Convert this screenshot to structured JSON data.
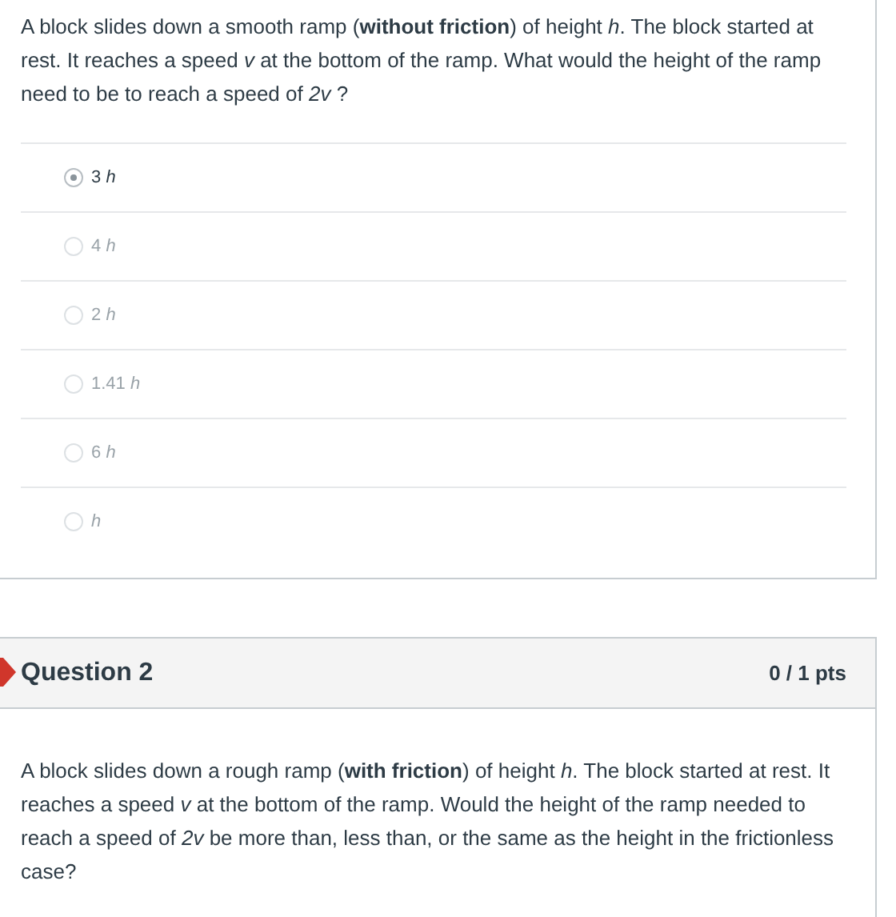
{
  "question_1": {
    "text": "A block slides down a smooth ramp (**without friction**) of height *h*.  The block started at rest.  It reaches a speed *v* at the bottom of the ramp.  What would the height of the ramp need to be to reach a speed of *2v* ?",
    "answers": [
      {
        "label": "3 *h*",
        "selected": true
      },
      {
        "label": "4 *h*",
        "selected": false
      },
      {
        "label": "2 *h*",
        "selected": false
      },
      {
        "label": "1.41 *h*",
        "selected": false
      },
      {
        "label": "6 *h*",
        "selected": false
      },
      {
        "label": "*h*",
        "selected": false
      }
    ]
  },
  "question_2": {
    "title": "Question 2",
    "points": "0 / 1 pts",
    "incorrect": true,
    "text": "A block slides down a rough ramp (**with friction**) of height *h*.  The block started at rest.  It reaches a speed *v* at the bottom of the ramp.  Would the height of the ramp needed to reach a speed of *2v* be more than, less than, or the same as the height in the frictionless case?"
  }
}
